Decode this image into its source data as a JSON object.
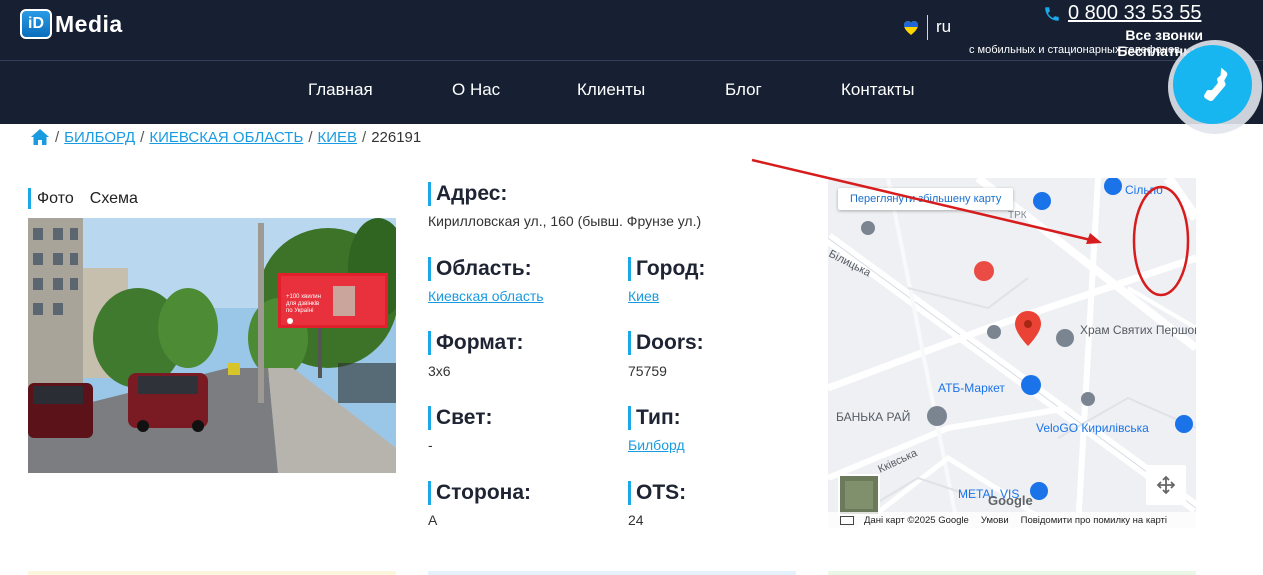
{
  "header": {
    "logo_badge": "iD",
    "logo_text": "Media",
    "lang": "ru",
    "phone": "0 800 33 53 55",
    "calls_free": "Все звонки Бесплатные",
    "calls_sub": "с мобильных и стационарных телефонов"
  },
  "nav": {
    "items": [
      "Главная",
      "О Нас",
      "Клиенты",
      "Блог",
      "Контакты"
    ]
  },
  "breadcrumb": {
    "items": [
      "БИЛБОРД",
      "КИЕВСКАЯ ОБЛАСТЬ",
      "КИЕВ"
    ],
    "current": "226191"
  },
  "tabs": [
    "Фото",
    "Схема"
  ],
  "fields": {
    "address_label": "Адрес:",
    "address_value": "Кирилловская ул., 160 (бывш. Фрунзе ул.)",
    "region_label": "Область:",
    "region_value": "Киевская область",
    "city_label": "Город:",
    "city_value": "Киев",
    "format_label": "Формат:",
    "format_value": "3x6",
    "doors_label": "Doors:",
    "doors_value": "75759",
    "light_label": "Свет:",
    "light_value": "-",
    "type_label": "Тип:",
    "type_value": "Билборд",
    "side_label": "Сторона:",
    "side_value": "A",
    "ots_label": "OTS:",
    "ots_value": "24"
  },
  "map": {
    "enlarge_button": "Переглянути збільшену карту",
    "labels": {
      "church": "Храм Святих Першоверховних.",
      "atb": "АТБ-Маркет",
      "banka": "БАНЬКА РАЙ",
      "velogo": "VeloGO Кирилівська",
      "metal": "METAL VIS",
      "street_bil": "Білицька",
      "street_kiv": "Кківська",
      "silpo": "Сільпо",
      "trk": "ТРК"
    },
    "footer_data": "Дані карт ©2025 Google",
    "footer_terms": "Умови",
    "footer_report": "Повідомити про помилку на карті",
    "google": "Google"
  },
  "billboard": {
    "text1": "+100 хвилин",
    "text2": "для дзвінків",
    "text3": "по Україні",
    "brand": "vodafone"
  },
  "colors": {
    "header_bg": "#162032",
    "accent": "#1aa8e8",
    "link": "#1a9be0",
    "annotation_red": "#d61c1c"
  }
}
